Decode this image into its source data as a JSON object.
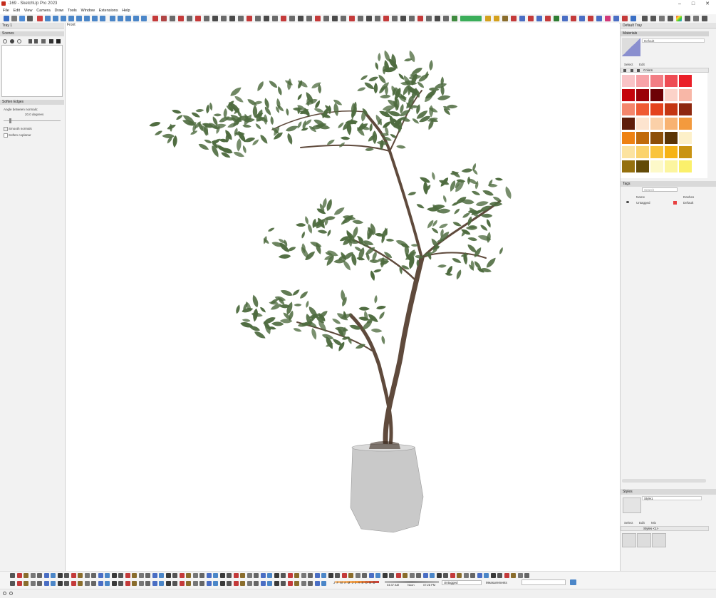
{
  "window": {
    "title": "·169 - SketchUp Pro 2023",
    "minimize": "–",
    "maximize": "□",
    "close": "✕"
  },
  "menu": [
    "File",
    "Edit",
    "View",
    "Camera",
    "Draw",
    "Tools",
    "Window",
    "Extensions",
    "Help"
  ],
  "left_tray": {
    "title": "Tray 1",
    "scenes": {
      "title": "Scenes"
    },
    "soften": {
      "title": "Soften Edges",
      "angle_label": "Angle between normals:",
      "angle_value": "20.0  degrees",
      "smooth_normals": "Smooth normals",
      "soften_coplanar": "Soften coplanar"
    }
  },
  "viewport": {
    "view_label": "Front"
  },
  "right_tray": {
    "title": "Default Tray",
    "materials": {
      "title": "Materials",
      "current_name": "Default",
      "tabs": [
        "Select",
        "Edit"
      ],
      "library": "Colors",
      "swatches": [
        "#f9c3c6",
        "#f7a3a8",
        "#f27d84",
        "#ee4c54",
        "#ea1f28",
        "#c5050c",
        "#9a0108",
        "#6d0106",
        "#fcd3c9",
        "#f8b7a7",
        "#f4866c",
        "#ef5a34",
        "#e4421d",
        "#c43612",
        "#8e280f",
        "#5e1d0a",
        "#fde4cf",
        "#fbd0a8",
        "#f8b271",
        "#f39a3d",
        "#ee8213",
        "#c06a0b",
        "#8d4f09",
        "#5c3506",
        "#fdf0c9",
        "#fce3a0",
        "#fbd36d",
        "#f9c43d",
        "#f6b316",
        "#c99312",
        "#95700e",
        "#634b08",
        "#fdf9c9",
        "#fcf59f",
        "#fbf06b"
      ]
    },
    "tags": {
      "title": "Tags",
      "search_placeholder": "Search",
      "col_name": "Name",
      "col_dashes": "Dashes",
      "rows": [
        {
          "name": "Untagged",
          "color": "#e84040",
          "dashes": "Default"
        }
      ]
    },
    "styles": {
      "title": "Styles",
      "style_name": "Style1",
      "tabs": [
        "Select",
        "Edit",
        "Mix"
      ],
      "library": "Styles <1>"
    }
  },
  "status": {
    "months": "J F M A M J J A S O N D",
    "time_am": "04:37 AM",
    "noon": "Noon",
    "time_pm": "07:28 PM",
    "tag": "Untagged",
    "measurements_label": "Measurements",
    "measurements_value": ""
  },
  "colors": {
    "toolbar_bg": "#f4f4f4",
    "tray_bg": "#f2f2f2",
    "leaf": "#4e6b3f",
    "trunk": "#5f4a3c",
    "pot": "#c9c9c9"
  }
}
